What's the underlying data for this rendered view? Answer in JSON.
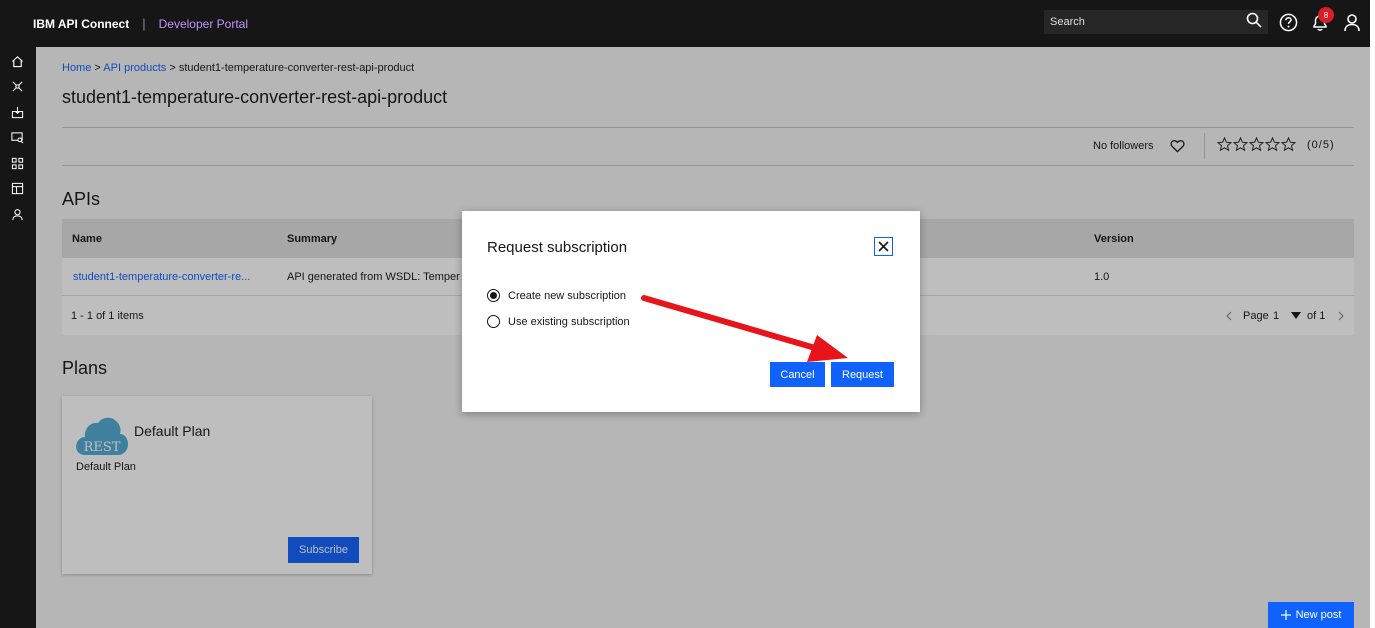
{
  "header": {
    "brand": "IBM API Connect",
    "separator": "|",
    "portal": "Developer Portal",
    "search_placeholder": "Search",
    "notification_count": "8"
  },
  "breadcrumb": {
    "home": "Home",
    "sep1": ">",
    "products": "API products",
    "sep2": ">",
    "current": "student1-temperature-converter-rest-api-product"
  },
  "page": {
    "title": "student1-temperature-converter-rest-api-product",
    "followers": "No followers",
    "rating": "(0/5)",
    "stars_filled": 0,
    "stars_total": 5
  },
  "apis": {
    "section_title": "APIs",
    "columns": [
      "Name",
      "Summary",
      "Version"
    ],
    "rows": [
      {
        "name": "student1-temperature-converter-re...",
        "summary": "API generated from WSDL: Temper",
        "version": "1.0"
      }
    ],
    "items_info": "1 - 1 of 1 items",
    "page_label": "Page",
    "page_value": "1",
    "of_pages": "of 1"
  },
  "plans": {
    "section_title": "Plans",
    "cards": [
      {
        "badge": "REST",
        "name": "Default Plan",
        "description": "Default Plan",
        "button": "Subscribe"
      }
    ]
  },
  "new_post": "New post",
  "modal": {
    "title": "Request subscription",
    "option_new": "Create new subscription",
    "option_existing": "Use existing subscription",
    "cancel": "Cancel",
    "request": "Request"
  },
  "colors": {
    "accent": "#0f62fe",
    "header_bg": "#161616",
    "annotation_arrow": "#e8141c"
  }
}
